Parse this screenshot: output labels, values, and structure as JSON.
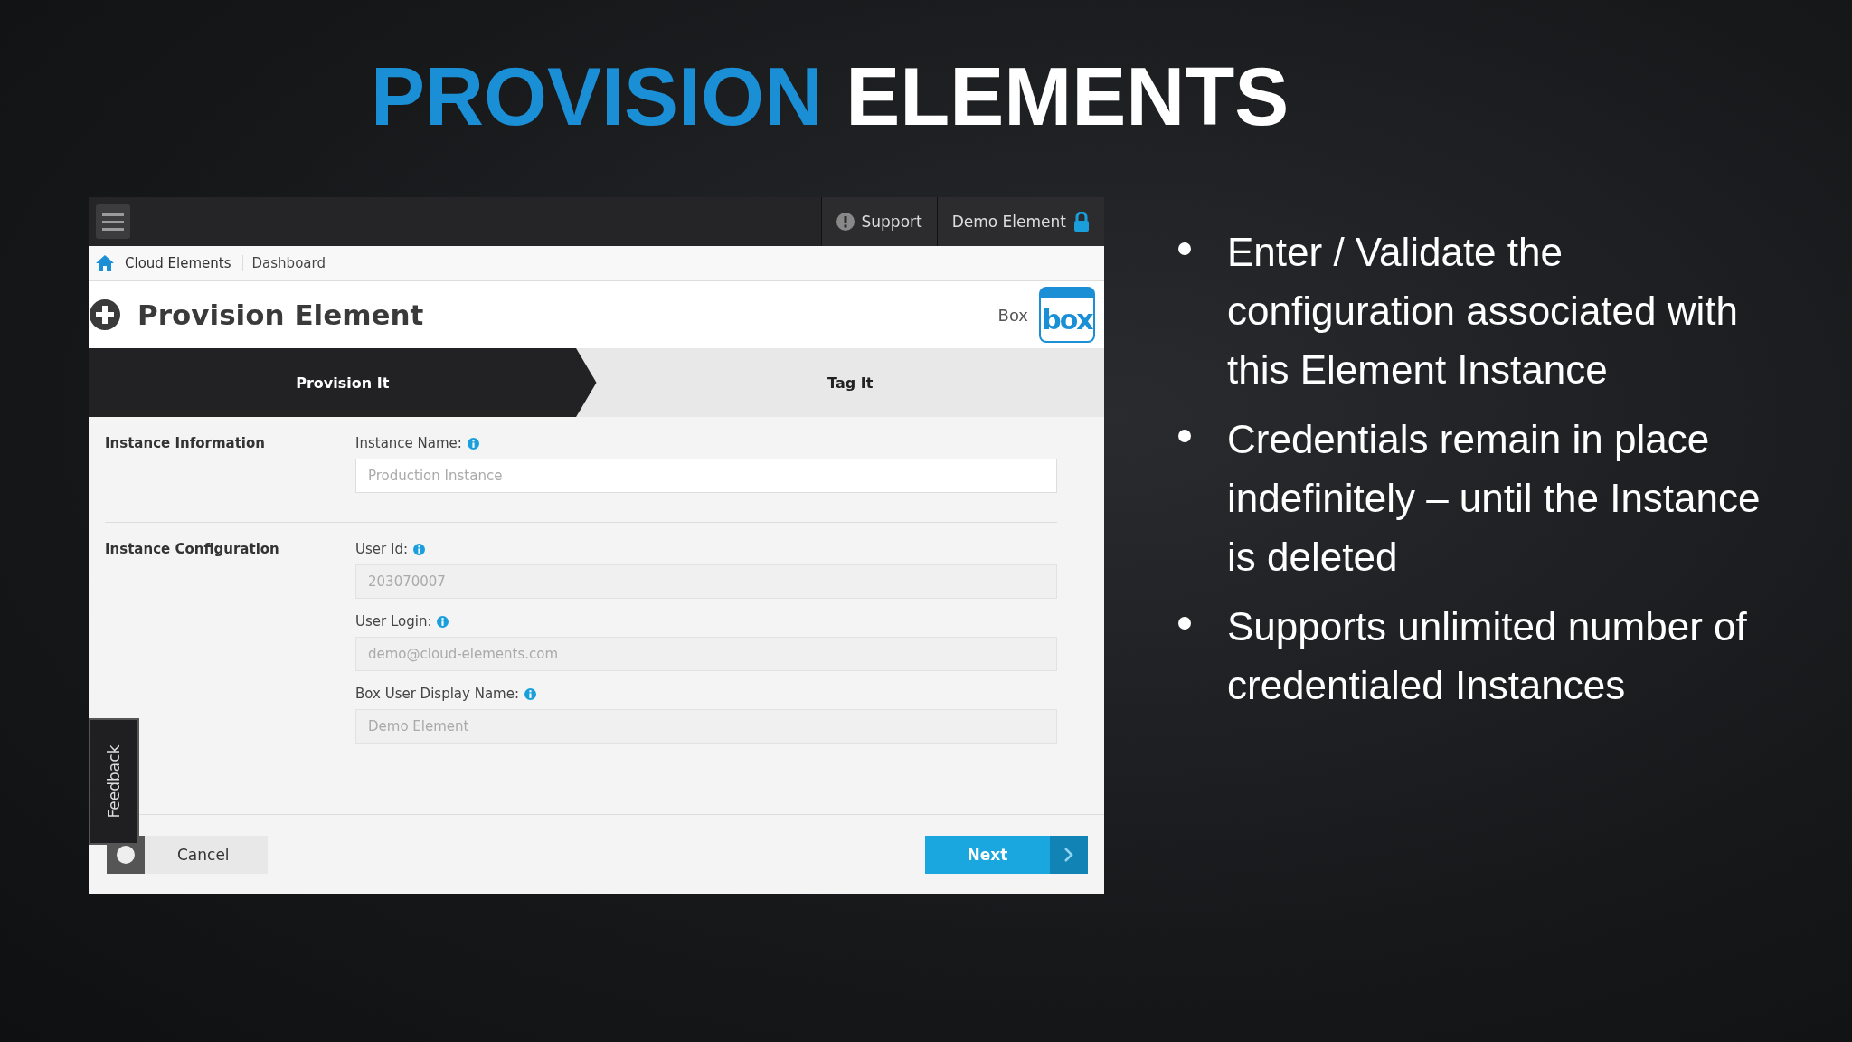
{
  "slide_title": {
    "accent": "PROVISION",
    "rest": "ELEMENTS"
  },
  "app": {
    "topbar": {
      "support": "Support",
      "user": "Demo Element"
    },
    "breadcrumb": [
      "Cloud Elements",
      "Dashboard"
    ],
    "header": {
      "title": "Provision Element",
      "element_name": "Box",
      "logo_text": "box"
    },
    "steps": [
      {
        "label": "Provision It",
        "selected": true
      },
      {
        "label": "Tag It",
        "selected": false
      }
    ],
    "sections": [
      {
        "title": "Instance Information",
        "fields": [
          {
            "label": "Instance Name:",
            "placeholder": "Production Instance",
            "disabled": false
          }
        ]
      },
      {
        "title": "Instance Configuration",
        "fields": [
          {
            "label": "User Id:",
            "value": "203070007",
            "disabled": true
          },
          {
            "label": "User Login:",
            "value": "demo@cloud-elements.com",
            "disabled": true
          },
          {
            "label": "Box User Display Name:",
            "value": "Demo Element",
            "disabled": true
          }
        ]
      }
    ],
    "feedback": "Feedback",
    "buttons": {
      "cancel": "Cancel",
      "next": "Next"
    }
  },
  "bullets": [
    "Enter / Validate the configuration associated with this Element Instance",
    "Credentials remain in place indefinitely – until the Instance is deleted",
    "Supports unlimited number of credentialed Instances"
  ]
}
